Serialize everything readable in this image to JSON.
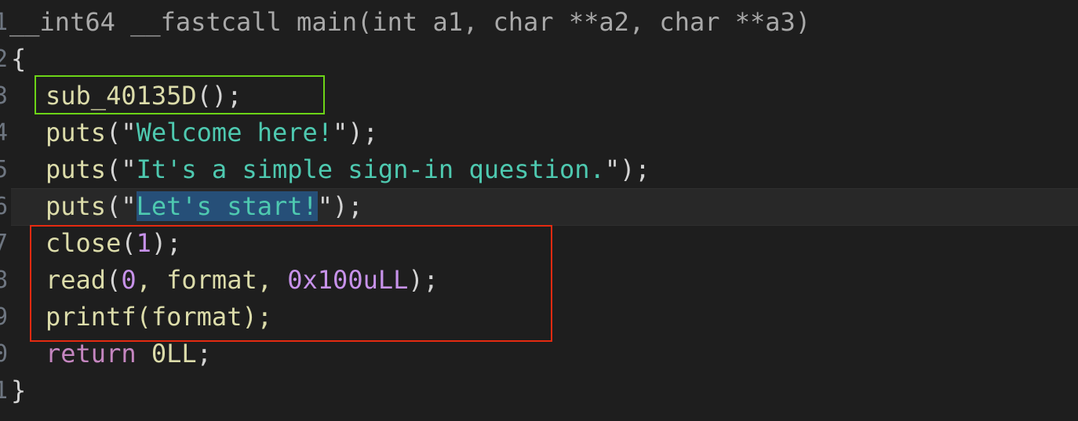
{
  "line_numbers": [
    "1",
    "2",
    "3",
    "4",
    "5",
    "6",
    "7",
    "8",
    "9",
    "0",
    "1"
  ],
  "code": {
    "signature": {
      "prefix": "__int64 __fastcall ",
      "name": "main",
      "params": "(int a1, char **a2, char **a3)"
    },
    "open_brace": "{",
    "line3": {
      "call": "sub_40135D",
      "tail": "();"
    },
    "line4": {
      "call": "puts",
      "open": "(\"",
      "str": "Welcome here!",
      "close": "\");"
    },
    "line5": {
      "call": "puts",
      "open": "(\"",
      "str": "It's a simple sign-in question.",
      "close": "\");"
    },
    "line6": {
      "call": "puts",
      "open": "(\"",
      "str": "Let's start!",
      "close": "\");"
    },
    "line7": {
      "call": "close",
      "open": "(",
      "arg": "1",
      "close": ");"
    },
    "line8": {
      "call": "read",
      "open": "(",
      "arg0": "0",
      "sep": ", format, ",
      "arg2": "0x100uLL",
      "close": ");"
    },
    "line9": {
      "call": "printf",
      "rest": "(format);"
    },
    "line10": {
      "kw": "return",
      "val": "0LL",
      "semi": ";"
    },
    "close_brace": "}"
  },
  "highlights": {
    "green_box_color": "#6cd417",
    "red_box_color": "#e52a10",
    "selection_color": "#264f78"
  }
}
